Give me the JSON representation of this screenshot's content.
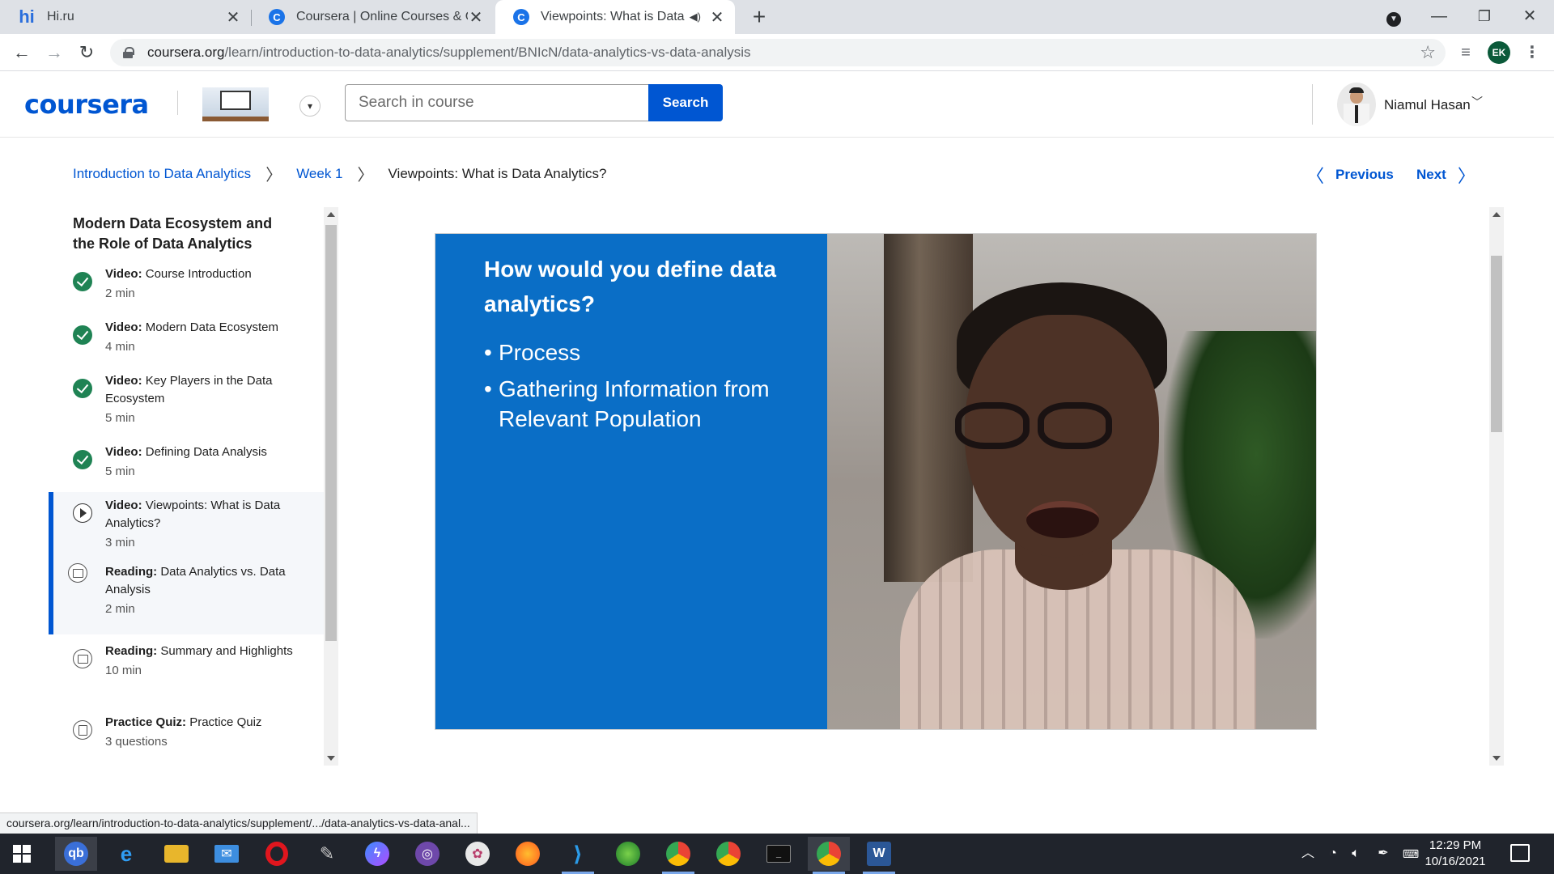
{
  "browser": {
    "tabs": [
      {
        "title": "Hi.ru",
        "favicon": "hi-icon"
      },
      {
        "title": "Coursera | Online Courses & Cred",
        "favicon": "coursera-icon"
      },
      {
        "title": "Viewpoints: What is Data An",
        "favicon": "coursera-icon",
        "active": true
      }
    ],
    "new_tab": "+",
    "url_host": "coursera.org",
    "url_path": "/learn/introduction-to-data-analytics/supplement/BNIcN/data-analytics-vs-data-analysis",
    "profile_initials": "EK"
  },
  "header": {
    "logo": "coursera",
    "search_placeholder": "Search in course",
    "search_button": "Search",
    "user_name": "Niamul Hasan"
  },
  "breadcrumb": {
    "course": "Introduction to Data Analytics",
    "week": "Week 1",
    "current": "Viewpoints: What is Data Analytics?"
  },
  "pager": {
    "previous": "Previous",
    "next": "Next"
  },
  "sidebar": {
    "module_title": "Modern Data Ecosystem and the Role of Data Analytics",
    "items": [
      {
        "type": "Video:",
        "title": "Course Introduction",
        "meta": "2 min",
        "status": "done"
      },
      {
        "type": "Video:",
        "title": "Modern Data Ecosystem",
        "meta": "4 min",
        "status": "done"
      },
      {
        "type": "Video:",
        "title": "Key Players in the Data Ecosystem",
        "meta": "5 min",
        "status": "done"
      },
      {
        "type": "Video:",
        "title": "Defining Data Analysis",
        "meta": "5 min",
        "status": "done"
      },
      {
        "type": "Video:",
        "title": "Viewpoints: What is Data Analytics?",
        "meta": "3 min",
        "status": "play"
      },
      {
        "type": "Reading:",
        "title": "Data Analytics vs. Data Analysis",
        "meta": "2 min",
        "status": "read"
      },
      {
        "type": "Reading:",
        "title": "Summary and Highlights",
        "meta": "10 min",
        "status": "read"
      },
      {
        "type": "Practice Quiz:",
        "title": "Practice Quiz",
        "meta": "3 questions",
        "status": "quiz"
      }
    ]
  },
  "video": {
    "slide_question": "How would you define data analytics?",
    "bullets": [
      "Process",
      "Gathering Information from Relevant Population"
    ]
  },
  "status_bar": "coursera.org/learn/introduction-to-data-analytics/supplement/.../data-analytics-vs-data-anal...",
  "taskbar": {
    "time": "12:29 PM",
    "date": "10/16/2021"
  },
  "colors": {
    "coursera_blue": "#0056d2",
    "slide_blue": "#0a6ec6",
    "done_green": "#1f8354",
    "taskbar": "#20242c"
  }
}
